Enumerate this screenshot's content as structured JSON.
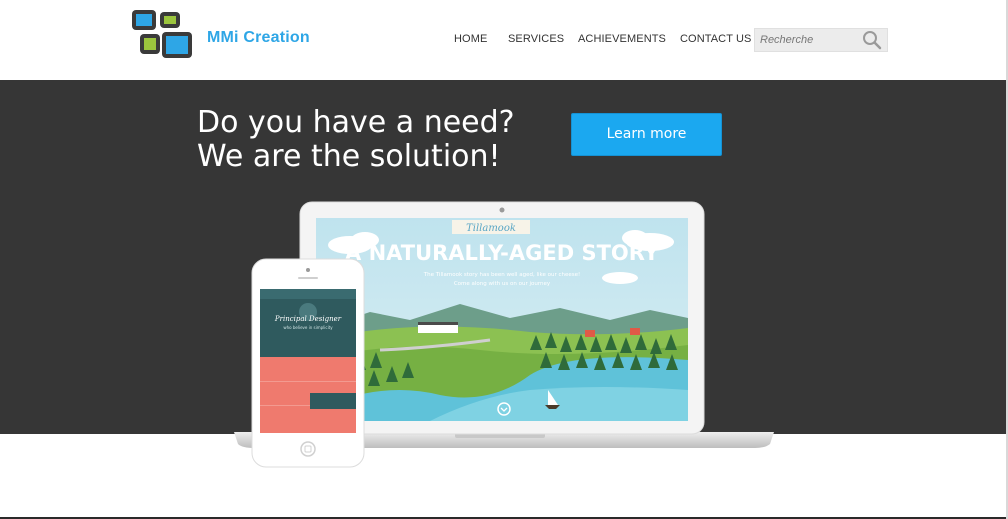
{
  "brand": {
    "name": "MMi Creation",
    "color": "#2ea6e6"
  },
  "nav": {
    "items": [
      {
        "label": "HOME"
      },
      {
        "label": "SERVICES"
      },
      {
        "label": "ACHIEVEMENTS"
      },
      {
        "label": "CONTACT US"
      }
    ]
  },
  "search": {
    "placeholder": "Recherche",
    "icon": "search-icon"
  },
  "hero": {
    "headline_line1": "Do you have a need?",
    "headline_line2": "We are the solution!",
    "cta_label": "Learn more",
    "background": "#363636",
    "accent": "#1ba8f0"
  },
  "laptop_screen": {
    "brand": "Tillamook",
    "title": "A NATURALLY-AGED STORY",
    "tagline_line1": "The Tillamook story has been well aged, like our cheese!",
    "tagline_line2": "Come along with us on our journey"
  },
  "phone_screen": {
    "title": "Principal Designer",
    "tagline": "who believe in simplicity"
  }
}
